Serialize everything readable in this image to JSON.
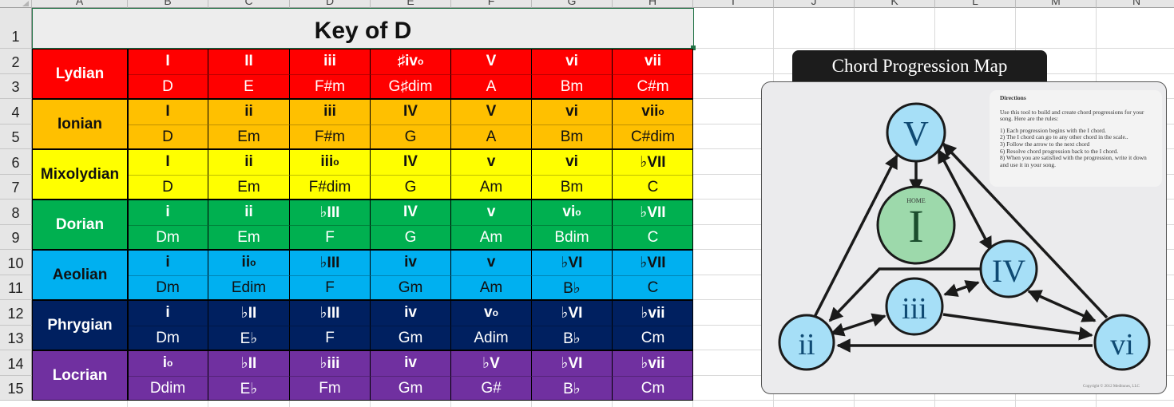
{
  "columns": [
    "A",
    "B",
    "C",
    "D",
    "E",
    "F",
    "G",
    "H",
    "I",
    "J",
    "K",
    "L",
    "M",
    "N"
  ],
  "rows": [
    "1",
    "2",
    "3",
    "4",
    "5",
    "6",
    "7",
    "8",
    "9",
    "10",
    "11",
    "12",
    "13",
    "14",
    "15"
  ],
  "title": "Key of D",
  "modes": [
    {
      "name": "Lydian",
      "bg": "#ff0000",
      "fg": "#ffffff",
      "numerals": [
        {
          "t": "I"
        },
        {
          "t": "II"
        },
        {
          "t": "iii"
        },
        {
          "t": "♯iv",
          "s": "o"
        },
        {
          "t": "V"
        },
        {
          "t": "vi"
        },
        {
          "t": "vii"
        }
      ],
      "chords": [
        "D",
        "E",
        "F#m",
        "G♯dim",
        "A",
        "Bm",
        "C#m"
      ]
    },
    {
      "name": "Ionian",
      "bg": "#ffc000",
      "fg": "#111111",
      "numerals": [
        {
          "t": "I"
        },
        {
          "t": "ii"
        },
        {
          "t": "iii"
        },
        {
          "t": "IV"
        },
        {
          "t": "V"
        },
        {
          "t": "vi"
        },
        {
          "t": "vii",
          "s": "o"
        }
      ],
      "chords": [
        "D",
        "Em",
        "F#m",
        "G",
        "A",
        "Bm",
        "C#dim"
      ]
    },
    {
      "name": "Mixolydian",
      "bg": "#ffff00",
      "fg": "#111111",
      "numerals": [
        {
          "t": "I"
        },
        {
          "t": "ii"
        },
        {
          "t": "iii",
          "s": "o"
        },
        {
          "t": "IV"
        },
        {
          "t": "v"
        },
        {
          "t": "vi"
        },
        {
          "t": "♭VII"
        }
      ],
      "chords": [
        "D",
        "Em",
        "F#dim",
        "G",
        "Am",
        "Bm",
        "C"
      ]
    },
    {
      "name": "Dorian",
      "bg": "#00b050",
      "fg": "#ffffff",
      "numerals": [
        {
          "t": "i"
        },
        {
          "t": "ii"
        },
        {
          "t": "♭III"
        },
        {
          "t": "IV"
        },
        {
          "t": "v"
        },
        {
          "t": "vi",
          "s": "o"
        },
        {
          "t": "♭VII"
        }
      ],
      "chords": [
        "Dm",
        "Em",
        "F",
        "G",
        "Am",
        "Bdim",
        "C"
      ]
    },
    {
      "name": "Aeolian",
      "bg": "#00b0f0",
      "fg": "#111111",
      "numerals": [
        {
          "t": "i"
        },
        {
          "t": "ii",
          "s": "o"
        },
        {
          "t": "♭III"
        },
        {
          "t": "iv"
        },
        {
          "t": "v"
        },
        {
          "t": "♭VI"
        },
        {
          "t": "♭VII"
        }
      ],
      "chords": [
        "Dm",
        "Edim",
        "F",
        "Gm",
        "Am",
        "B♭",
        "C"
      ]
    },
    {
      "name": "Phrygian",
      "bg": "#002060",
      "fg": "#ffffff",
      "numerals": [
        {
          "t": "i"
        },
        {
          "t": "♭II"
        },
        {
          "t": "♭III"
        },
        {
          "t": "iv"
        },
        {
          "t": "v",
          "s": "o"
        },
        {
          "t": "♭VI"
        },
        {
          "t": "♭vii"
        }
      ],
      "chords": [
        "Dm",
        "E♭",
        "F",
        "Gm",
        "Adim",
        "B♭",
        "Cm"
      ]
    },
    {
      "name": "Locrian",
      "bg": "#7030a0",
      "fg": "#ffffff",
      "numerals": [
        {
          "t": "i",
          "s": "o"
        },
        {
          "t": "♭II"
        },
        {
          "t": "♭iii"
        },
        {
          "t": "iv"
        },
        {
          "t": "♭V"
        },
        {
          "t": "♭VI"
        },
        {
          "t": "♭vii"
        }
      ],
      "chords": [
        "Ddim",
        "E♭",
        "Fm",
        "Gm",
        "G#",
        "B♭",
        "Cm"
      ]
    }
  ],
  "map": {
    "title": "Chord Progression Map",
    "home_label": "HOME",
    "nodes": {
      "V": "V",
      "I": "I",
      "IV": "IV",
      "iii": "iii",
      "ii": "ii",
      "vi": "vi"
    },
    "directions_title": "Directions",
    "directions_intro": "Use this tool to build and create chord progressions for your song.  Here are the rules:",
    "rules": [
      "1)   Each progression begins with the I chord.",
      "2)   The I chord can go to any other chord in the scale..",
      "3)   Follow the arrow to the next chord",
      "6)   Resolve chord progression back to the I chord.",
      "8)   When you are satisfied with the progression, write it down and use it in your song."
    ],
    "copyright": "Copyright © 2012 Meditunes, LLC",
    "node_fill": "#a6dff7",
    "home_fill": "#9dd9ab"
  }
}
